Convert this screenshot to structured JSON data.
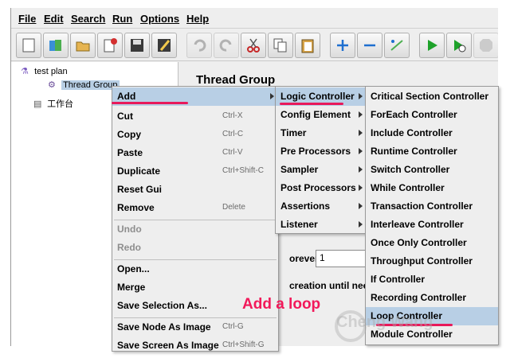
{
  "menubar": {
    "items": [
      {
        "label": "File"
      },
      {
        "label": "Edit"
      },
      {
        "label": "Search"
      },
      {
        "label": "Run"
      },
      {
        "label": "Options"
      },
      {
        "label": "Help"
      }
    ]
  },
  "toolbar": {
    "buttons": [
      "new-icon",
      "templates-icon",
      "open-icon",
      "close-icon",
      "save-icon",
      "save-as-icon",
      "undo-icon",
      "redo-icon",
      "cut-icon",
      "copy-icon",
      "paste-icon",
      "expand-icon",
      "collapse-icon",
      "toggle-icon",
      "start-icon",
      "start-no-pauses-icon",
      "stop-icon"
    ]
  },
  "tree": {
    "root": "test plan",
    "child": "Thread Group",
    "workbench": "工作台"
  },
  "panel": {
    "title": "Thread Group",
    "loop_label": "orever",
    "loop_value": "1",
    "delay_label": "creation until neede"
  },
  "context_menu": {
    "items": [
      {
        "label": "Add",
        "shortcut": ""
      },
      {
        "label": "Cut",
        "shortcut": "Ctrl-X"
      },
      {
        "label": "Copy",
        "shortcut": "Ctrl-C"
      },
      {
        "label": "Paste",
        "shortcut": "Ctrl-V"
      },
      {
        "label": "Duplicate",
        "shortcut": "Ctrl+Shift-C"
      },
      {
        "label": "Reset Gui",
        "shortcut": ""
      },
      {
        "label": "Remove",
        "shortcut": "Delete"
      },
      {
        "label": "Undo",
        "shortcut": ""
      },
      {
        "label": "Redo",
        "shortcut": ""
      },
      {
        "label": "Open...",
        "shortcut": ""
      },
      {
        "label": "Merge",
        "shortcut": ""
      },
      {
        "label": "Save Selection As...",
        "shortcut": ""
      },
      {
        "label": "Save Node As Image",
        "shortcut": "Ctrl-G"
      },
      {
        "label": "Save Screen As Image",
        "shortcut": "Ctrl+Shift-G"
      }
    ]
  },
  "add_menu": {
    "items": [
      "Logic Controller",
      "Config Element",
      "Timer",
      "Pre Processors",
      "Sampler",
      "Post Processors",
      "Assertions",
      "Listener"
    ]
  },
  "logic_menu": {
    "items": [
      "Critical Section Controller",
      "ForEach Controller",
      "Include Controller",
      "Runtime Controller",
      "Switch Controller",
      "While Controller",
      "Transaction Controller",
      "Interleave Controller",
      "Once Only Controller",
      "Throughput Controller",
      "If Controller",
      "Recording Controller",
      "Loop Controller",
      "Module Controller"
    ]
  },
  "annotation": {
    "text": "Add a loop",
    "color": "#f2195a"
  },
  "watermark": {
    "text": "Cheng Wang"
  },
  "colors": {
    "highlight": "#b8cfe5",
    "underline": "#e8195a"
  }
}
